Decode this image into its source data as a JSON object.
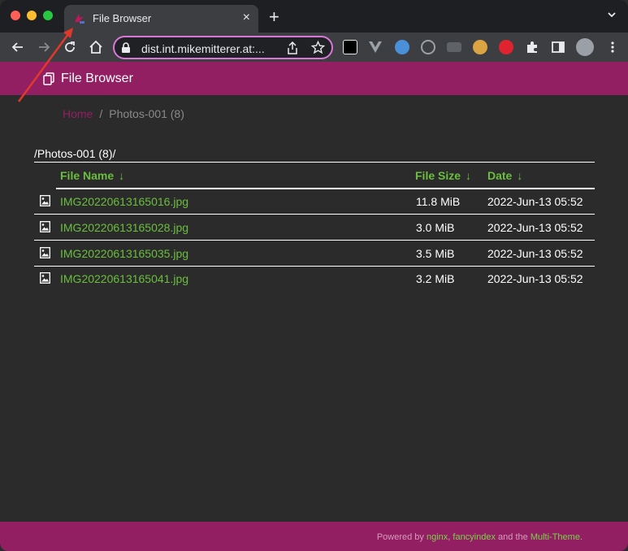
{
  "browser": {
    "tab_title": "File Browser",
    "tab_close": "×",
    "new_tab": "+",
    "url": "dist.int.mikemitterer.at:..."
  },
  "header": {
    "title": "File Browser"
  },
  "breadcrumb": {
    "home": "Home",
    "separator": "/",
    "current": "Photos-001 (8)"
  },
  "listing": {
    "path": "/Photos-001 (8)/",
    "columns": {
      "name": "File Name",
      "size": "File Size",
      "date": "Date",
      "sort_arrow": "↓"
    },
    "files": [
      {
        "name": "IMG20220613165016.jpg",
        "size": "11.8 MiB",
        "date": "2022-Jun-13 05:52"
      },
      {
        "name": "IMG20220613165028.jpg",
        "size": "3.0 MiB",
        "date": "2022-Jun-13 05:52"
      },
      {
        "name": "IMG20220613165035.jpg",
        "size": "3.5 MiB",
        "date": "2022-Jun-13 05:52"
      },
      {
        "name": "IMG20220613165041.jpg",
        "size": "3.2 MiB",
        "date": "2022-Jun-13 05:52"
      }
    ]
  },
  "footer": {
    "prefix": "Powered by",
    "link1": "nginx",
    "comma": ",",
    "link2": "fancyindex",
    "mid": "and the",
    "link3": "Multi-Theme",
    "suffix": "."
  },
  "colors": {
    "accent": "#931f63",
    "link": "#6abf3e",
    "background": "#2b2b2b"
  }
}
